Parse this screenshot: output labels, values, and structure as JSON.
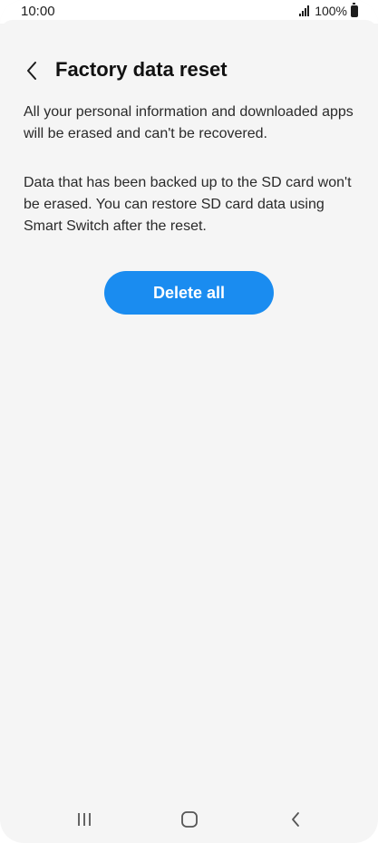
{
  "status_bar": {
    "time": "10:00",
    "battery_text": "100%",
    "icons": [
      "signal-icon",
      "battery-icon"
    ]
  },
  "header": {
    "back_icon": "chevron-left-icon",
    "title": "Factory data reset"
  },
  "content": {
    "paragraph_1": "All your personal information and downloaded apps will be erased and can't be recovered.",
    "paragraph_2": "Data that has been backed up to the SD card won't be erased. You can restore SD card data using Smart Switch after the reset.",
    "delete_button_label": "Delete all"
  },
  "nav_bar": {
    "icons": [
      "recents-icon",
      "home-icon",
      "back-icon"
    ]
  },
  "colors": {
    "accent": "#1a8cf0",
    "background": "#f5f5f5",
    "text": "#1b1b1b"
  }
}
